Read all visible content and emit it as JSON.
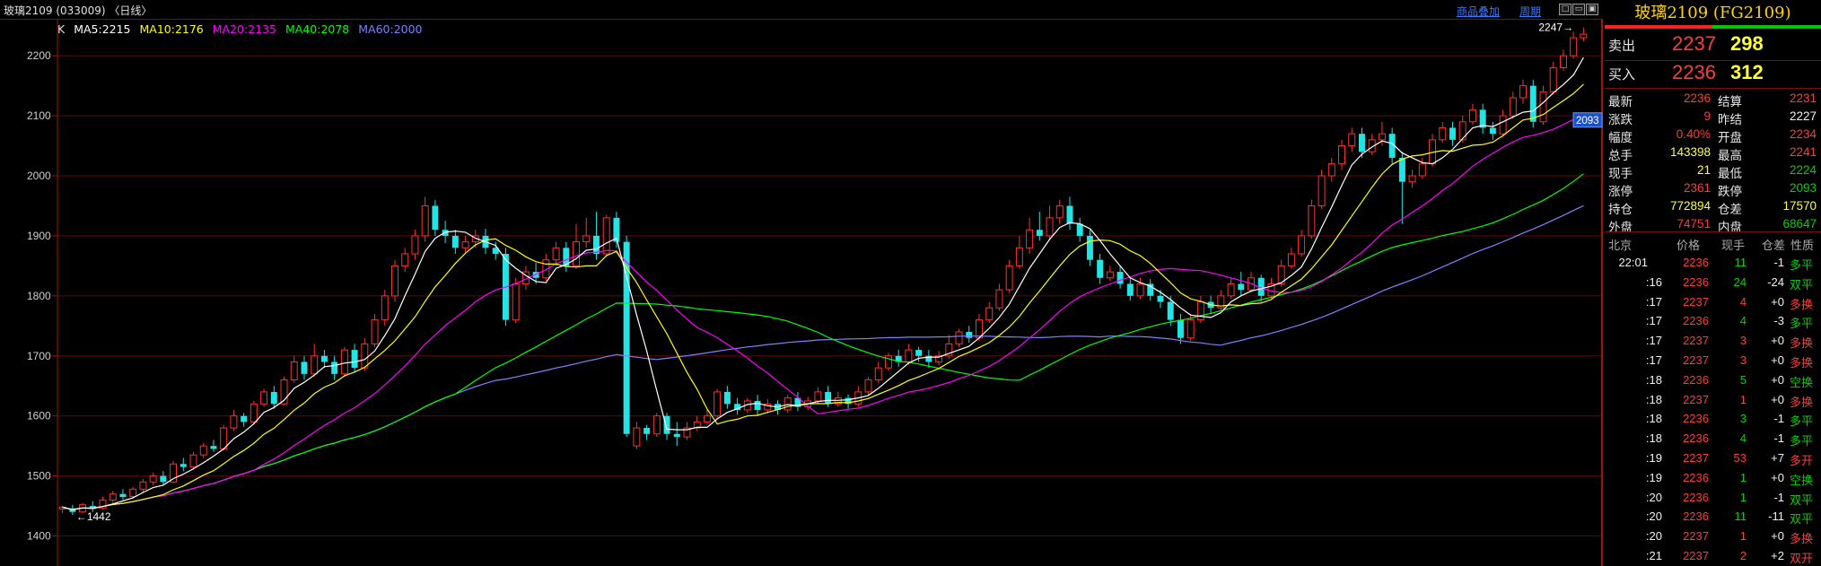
{
  "header": {
    "title": "玻璃2109 (033009) 〈日线〉",
    "link_overlay": "商品叠加",
    "link_period": "周期",
    "win_buttons": [
      "□",
      "▭",
      "▣"
    ]
  },
  "ma_legend": {
    "k": "K",
    "ma5": "MA5:2215",
    "ma10": "MA10:2176",
    "ma20": "MA20:2135",
    "ma40": "MA40:2078",
    "ma60": "MA60:2000"
  },
  "colors": {
    "up": "#ff3030",
    "down": "#22e4e4",
    "ma5": "#ffffff",
    "ma10": "#ffff00",
    "ma20": "#ff00ff",
    "ma40": "#00ff00",
    "ma60": "#8080ff",
    "grid": "#5a0a0a"
  },
  "chart_data": {
    "type": "candlestick",
    "ylim": [
      1350,
      2260
    ],
    "y_ticks": [
      "2200",
      "2100",
      "2000",
      "1900",
      "1800",
      "1700",
      "1600",
      "1500",
      "1400"
    ],
    "y_tick_values": [
      2200,
      2100,
      2000,
      1900,
      1800,
      1700,
      1600,
      1500,
      1400
    ],
    "annotations": {
      "high": "2247",
      "low": "1442"
    },
    "right_marker": "2093",
    "candles": [
      [
        1445,
        1448,
        1438,
        1450
      ],
      [
        1446,
        1440,
        1435,
        1452
      ],
      [
        1440,
        1452,
        1438,
        1455
      ],
      [
        1450,
        1445,
        1440,
        1458
      ],
      [
        1446,
        1460,
        1444,
        1465
      ],
      [
        1460,
        1470,
        1455,
        1475
      ],
      [
        1470,
        1465,
        1460,
        1478
      ],
      [
        1466,
        1478,
        1462,
        1482
      ],
      [
        1478,
        1490,
        1472,
        1495
      ],
      [
        1490,
        1500,
        1485,
        1505
      ],
      [
        1500,
        1490,
        1486,
        1508
      ],
      [
        1490,
        1520,
        1488,
        1525
      ],
      [
        1520,
        1515,
        1508,
        1530
      ],
      [
        1515,
        1535,
        1510,
        1540
      ],
      [
        1535,
        1550,
        1530,
        1555
      ],
      [
        1550,
        1545,
        1540,
        1560
      ],
      [
        1545,
        1580,
        1542,
        1585
      ],
      [
        1580,
        1600,
        1575,
        1610
      ],
      [
        1600,
        1590,
        1582,
        1605
      ],
      [
        1590,
        1620,
        1586,
        1625
      ],
      [
        1620,
        1640,
        1615,
        1645
      ],
      [
        1640,
        1620,
        1612,
        1650
      ],
      [
        1620,
        1660,
        1618,
        1665
      ],
      [
        1660,
        1690,
        1655,
        1700
      ],
      [
        1690,
        1670,
        1660,
        1700
      ],
      [
        1670,
        1700,
        1665,
        1720
      ],
      [
        1700,
        1690,
        1680,
        1710
      ],
      [
        1690,
        1670,
        1660,
        1700
      ],
      [
        1670,
        1710,
        1665,
        1715
      ],
      [
        1710,
        1680,
        1672,
        1720
      ],
      [
        1680,
        1720,
        1675,
        1730
      ],
      [
        1720,
        1760,
        1715,
        1770
      ],
      [
        1760,
        1800,
        1750,
        1810
      ],
      [
        1800,
        1850,
        1790,
        1860
      ],
      [
        1850,
        1870,
        1840,
        1880
      ],
      [
        1870,
        1900,
        1860,
        1910
      ],
      [
        1900,
        1950,
        1890,
        1965
      ],
      [
        1950,
        1910,
        1900,
        1960
      ],
      [
        1910,
        1900,
        1888,
        1925
      ],
      [
        1900,
        1880,
        1870,
        1910
      ],
      [
        1880,
        1890,
        1872,
        1900
      ],
      [
        1890,
        1900,
        1880,
        1910
      ],
      [
        1900,
        1880,
        1870,
        1912
      ],
      [
        1880,
        1870,
        1860,
        1890
      ],
      [
        1870,
        1760,
        1750,
        1880
      ],
      [
        1760,
        1820,
        1755,
        1830
      ],
      [
        1820,
        1840,
        1810,
        1850
      ],
      [
        1840,
        1830,
        1820,
        1855
      ],
      [
        1830,
        1860,
        1825,
        1870
      ],
      [
        1860,
        1880,
        1850,
        1890
      ],
      [
        1880,
        1850,
        1840,
        1890
      ],
      [
        1850,
        1890,
        1845,
        1920
      ],
      [
        1890,
        1900,
        1880,
        1930
      ],
      [
        1900,
        1870,
        1860,
        1940
      ],
      [
        1870,
        1930,
        1865,
        1935
      ],
      [
        1930,
        1890,
        1880,
        1940
      ],
      [
        1890,
        1570,
        1565,
        1900
      ],
      [
        1550,
        1580,
        1545,
        1590
      ],
      [
        1580,
        1570,
        1560,
        1585
      ],
      [
        1570,
        1600,
        1565,
        1605
      ],
      [
        1600,
        1570,
        1560,
        1605
      ],
      [
        1570,
        1565,
        1550,
        1590
      ],
      [
        1565,
        1580,
        1560,
        1590
      ],
      [
        1580,
        1590,
        1575,
        1600
      ],
      [
        1590,
        1600,
        1585,
        1610
      ],
      [
        1600,
        1640,
        1595,
        1645
      ],
      [
        1640,
        1620,
        1612,
        1650
      ],
      [
        1620,
        1610,
        1602,
        1630
      ],
      [
        1610,
        1625,
        1605,
        1630
      ],
      [
        1625,
        1610,
        1600,
        1635
      ],
      [
        1610,
        1620,
        1604,
        1628
      ],
      [
        1620,
        1610,
        1602,
        1626
      ],
      [
        1610,
        1630,
        1605,
        1635
      ],
      [
        1630,
        1615,
        1608,
        1640
      ],
      [
        1615,
        1625,
        1610,
        1632
      ],
      [
        1625,
        1640,
        1620,
        1648
      ],
      [
        1640,
        1620,
        1615,
        1650
      ],
      [
        1620,
        1630,
        1615,
        1640
      ],
      [
        1630,
        1620,
        1612,
        1636
      ],
      [
        1620,
        1640,
        1615,
        1650
      ],
      [
        1640,
        1660,
        1635,
        1665
      ],
      [
        1660,
        1680,
        1655,
        1690
      ],
      [
        1680,
        1700,
        1675,
        1705
      ],
      [
        1700,
        1690,
        1682,
        1710
      ],
      [
        1690,
        1710,
        1685,
        1720
      ],
      [
        1710,
        1700,
        1690,
        1715
      ],
      [
        1700,
        1690,
        1680,
        1710
      ],
      [
        1690,
        1700,
        1684,
        1708
      ],
      [
        1700,
        1720,
        1695,
        1735
      ],
      [
        1720,
        1740,
        1715,
        1745
      ],
      [
        1740,
        1730,
        1722,
        1750
      ],
      [
        1730,
        1760,
        1725,
        1770
      ],
      [
        1760,
        1780,
        1755,
        1790
      ],
      [
        1780,
        1810,
        1775,
        1820
      ],
      [
        1810,
        1850,
        1805,
        1860
      ],
      [
        1850,
        1880,
        1845,
        1900
      ],
      [
        1880,
        1910,
        1870,
        1930
      ],
      [
        1910,
        1900,
        1892,
        1940
      ],
      [
        1900,
        1930,
        1895,
        1950
      ],
      [
        1930,
        1950,
        1920,
        1960
      ],
      [
        1950,
        1920,
        1910,
        1965
      ],
      [
        1920,
        1900,
        1890,
        1930
      ],
      [
        1900,
        1860,
        1850,
        1910
      ],
      [
        1860,
        1830,
        1820,
        1870
      ],
      [
        1830,
        1840,
        1825,
        1850
      ],
      [
        1840,
        1820,
        1812,
        1850
      ],
      [
        1820,
        1800,
        1792,
        1830
      ],
      [
        1800,
        1820,
        1795,
        1830
      ],
      [
        1820,
        1800,
        1792,
        1828
      ],
      [
        1800,
        1790,
        1780,
        1810
      ],
      [
        1790,
        1760,
        1750,
        1800
      ],
      [
        1760,
        1730,
        1720,
        1770
      ],
      [
        1730,
        1760,
        1725,
        1770
      ],
      [
        1760,
        1790,
        1755,
        1800
      ],
      [
        1790,
        1780,
        1770,
        1800
      ],
      [
        1780,
        1800,
        1775,
        1810
      ],
      [
        1800,
        1820,
        1795,
        1830
      ],
      [
        1820,
        1810,
        1800,
        1840
      ],
      [
        1810,
        1830,
        1805,
        1840
      ],
      [
        1830,
        1800,
        1790,
        1835
      ],
      [
        1800,
        1820,
        1795,
        1830
      ],
      [
        1820,
        1850,
        1815,
        1860
      ],
      [
        1850,
        1870,
        1845,
        1880
      ],
      [
        1870,
        1900,
        1865,
        1910
      ],
      [
        1900,
        1950,
        1895,
        1960
      ],
      [
        1950,
        2000,
        1945,
        2010
      ],
      [
        2000,
        2020,
        1990,
        2030
      ],
      [
        2020,
        2050,
        2010,
        2060
      ],
      [
        2050,
        2070,
        2040,
        2080
      ],
      [
        2070,
        2040,
        2030,
        2080
      ],
      [
        2040,
        2060,
        2035,
        2070
      ],
      [
        2060,
        2070,
        2050,
        2090
      ],
      [
        2070,
        2030,
        2020,
        2080
      ],
      [
        2030,
        1990,
        1920,
        2040
      ],
      [
        1990,
        2000,
        1980,
        2010
      ],
      [
        2000,
        2020,
        1995,
        2030
      ],
      [
        2020,
        2060,
        2015,
        2070
      ],
      [
        2060,
        2080,
        2055,
        2090
      ],
      [
        2080,
        2060,
        2050,
        2090
      ],
      [
        2060,
        2090,
        2055,
        2100
      ],
      [
        2090,
        2110,
        2085,
        2120
      ],
      [
        2110,
        2080,
        2070,
        2120
      ],
      [
        2080,
        2070,
        2060,
        2090
      ],
      [
        2070,
        2100,
        2065,
        2110
      ],
      [
        2100,
        2130,
        2095,
        2140
      ],
      [
        2130,
        2150,
        2120,
        2160
      ],
      [
        2150,
        2090,
        2080,
        2160
      ],
      [
        2090,
        2140,
        2085,
        2150
      ],
      [
        2140,
        2180,
        2135,
        2190
      ],
      [
        2180,
        2200,
        2175,
        2210
      ],
      [
        2200,
        2230,
        2195,
        2240
      ],
      [
        2230,
        2236,
        2224,
        2247
      ]
    ]
  },
  "panel": {
    "title": "玻璃2109 (FG2109)",
    "sell_label": "卖出",
    "sell_price": "2237",
    "sell_vol": "298",
    "buy_label": "买入",
    "buy_price": "2236",
    "buy_vol": "312",
    "stats": [
      {
        "l1": "最新",
        "v1": "2236",
        "c1": "red",
        "l2": "结算",
        "v2": "2231",
        "c2": "red"
      },
      {
        "l1": "涨跌",
        "v1": "9",
        "c1": "red",
        "l2": "昨结",
        "v2": "2227",
        "c2": "white"
      },
      {
        "l1": "幅度",
        "v1": "0.40%",
        "c1": "red",
        "l2": "开盘",
        "v2": "2234",
        "c2": "red"
      },
      {
        "l1": "总手",
        "v1": "143398",
        "c1": "yellow",
        "l2": "最高",
        "v2": "2241",
        "c2": "red"
      },
      {
        "l1": "现手",
        "v1": "21",
        "c1": "yellow",
        "l2": "最低",
        "v2": "2224",
        "c2": "green"
      },
      {
        "l1": "涨停",
        "v1": "2361",
        "c1": "red",
        "l2": "跌停",
        "v2": "2093",
        "c2": "green"
      },
      {
        "l1": "持仓",
        "v1": "772894",
        "c1": "yellow",
        "l2": "仓差",
        "v2": "17570",
        "c2": "yellow"
      },
      {
        "l1": "外盘",
        "v1": "74751",
        "c1": "red",
        "l2": "内盘",
        "v2": "68647",
        "c2": "green"
      }
    ],
    "trade_headers": [
      "北京",
      "价格",
      "现手",
      "仓差",
      "性质"
    ],
    "trades": [
      {
        "t": "22:01",
        "p": "2236",
        "pc": "red",
        "v": "11",
        "vc": "green",
        "d": "-1",
        "k": "多平",
        "kc": "green"
      },
      {
        "t": ":16",
        "p": "2236",
        "pc": "red",
        "v": "24",
        "vc": "green",
        "d": "-24",
        "k": "双平",
        "kc": "green"
      },
      {
        "t": ":17",
        "p": "2237",
        "pc": "red",
        "v": "4",
        "vc": "red",
        "d": "+0",
        "k": "多换",
        "kc": "red"
      },
      {
        "t": ":17",
        "p": "2236",
        "pc": "red",
        "v": "4",
        "vc": "green",
        "d": "-3",
        "k": "多平",
        "kc": "green"
      },
      {
        "t": ":17",
        "p": "2237",
        "pc": "red",
        "v": "3",
        "vc": "red",
        "d": "+0",
        "k": "多换",
        "kc": "red"
      },
      {
        "t": ":17",
        "p": "2237",
        "pc": "red",
        "v": "3",
        "vc": "red",
        "d": "+0",
        "k": "多换",
        "kc": "red"
      },
      {
        "t": ":18",
        "p": "2236",
        "pc": "red",
        "v": "5",
        "vc": "green",
        "d": "+0",
        "k": "空换",
        "kc": "green"
      },
      {
        "t": ":18",
        "p": "2237",
        "pc": "red",
        "v": "1",
        "vc": "red",
        "d": "+0",
        "k": "多换",
        "kc": "red"
      },
      {
        "t": ":18",
        "p": "2236",
        "pc": "red",
        "v": "3",
        "vc": "green",
        "d": "-1",
        "k": "多平",
        "kc": "green"
      },
      {
        "t": ":18",
        "p": "2236",
        "pc": "red",
        "v": "4",
        "vc": "green",
        "d": "-1",
        "k": "多平",
        "kc": "green"
      },
      {
        "t": ":19",
        "p": "2237",
        "pc": "red",
        "v": "53",
        "vc": "red",
        "d": "+7",
        "k": "多开",
        "kc": "red"
      },
      {
        "t": ":19",
        "p": "2236",
        "pc": "red",
        "v": "1",
        "vc": "green",
        "d": "+0",
        "k": "空换",
        "kc": "green"
      },
      {
        "t": ":20",
        "p": "2236",
        "pc": "red",
        "v": "1",
        "vc": "green",
        "d": "-1",
        "k": "双平",
        "kc": "green"
      },
      {
        "t": ":20",
        "p": "2236",
        "pc": "red",
        "v": "11",
        "vc": "green",
        "d": "-11",
        "k": "双平",
        "kc": "green"
      },
      {
        "t": ":20",
        "p": "2237",
        "pc": "red",
        "v": "1",
        "vc": "red",
        "d": "+0",
        "k": "多换",
        "kc": "red"
      },
      {
        "t": ":21",
        "p": "2237",
        "pc": "red",
        "v": "2",
        "vc": "red",
        "d": "+2",
        "k": "双开",
        "kc": "red"
      }
    ]
  }
}
